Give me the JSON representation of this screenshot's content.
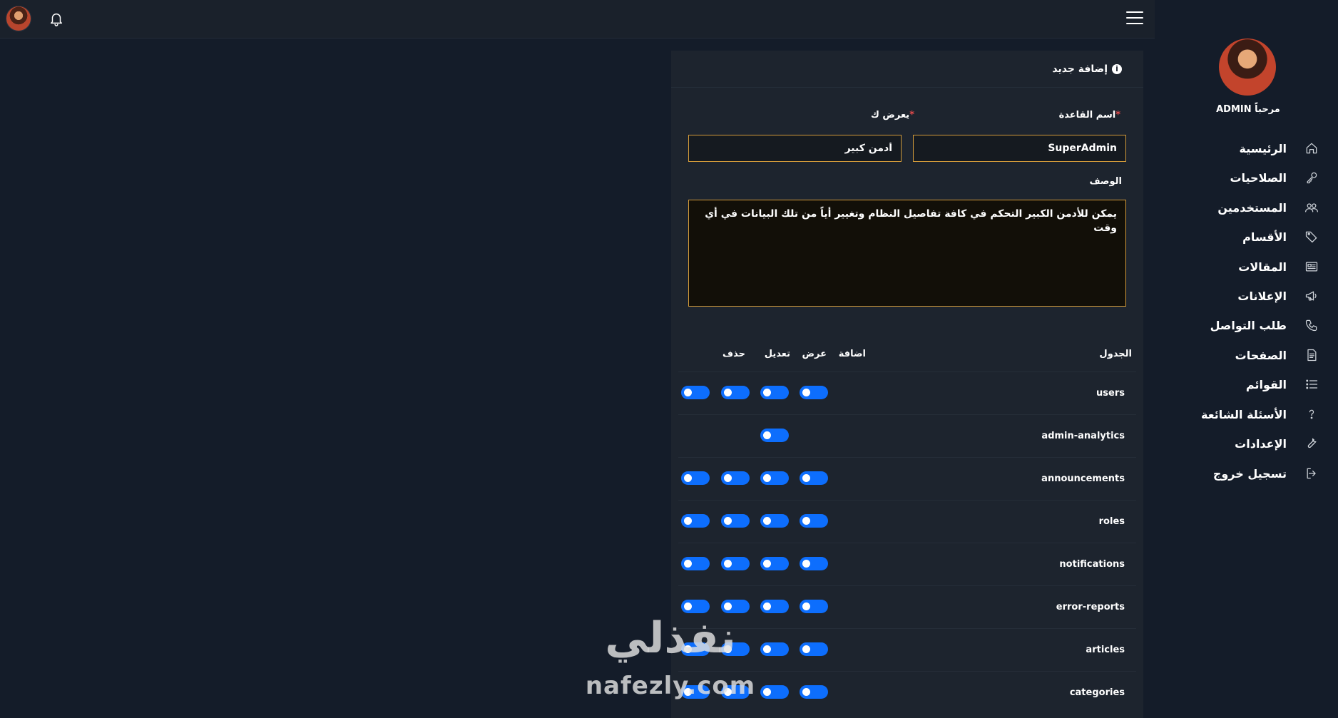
{
  "sidebar": {
    "welcome": "مرحباً ADMIN",
    "items": [
      {
        "label": "الرئيسية",
        "icon": "home-icon"
      },
      {
        "label": "الصلاحيات",
        "icon": "key-icon"
      },
      {
        "label": "المستخدمين",
        "icon": "users-icon"
      },
      {
        "label": "الأقسام",
        "icon": "tag-icon"
      },
      {
        "label": "المقالات",
        "icon": "newspaper-icon"
      },
      {
        "label": "الإعلانات",
        "icon": "megaphone-icon"
      },
      {
        "label": "طلب التواصل",
        "icon": "phone-icon"
      },
      {
        "label": "الصفحات",
        "icon": "page-icon"
      },
      {
        "label": "القوائم",
        "icon": "list-icon"
      },
      {
        "label": "الأسئلة الشائعة",
        "icon": "question-icon"
      },
      {
        "label": "الإعدادات",
        "icon": "wrench-icon"
      },
      {
        "label": "تسجيل خروج",
        "icon": "logout-icon"
      }
    ]
  },
  "form": {
    "title": "إضافة جديد",
    "name_label": "اسم القاعدة",
    "name_value": "SuperAdmin",
    "display_label": "يعرض ك",
    "display_value": "أدمن كبير",
    "required_mark": "*",
    "description_label": "الوصف",
    "description_value": "يمكن للأدمن الكبير التحكم في كافة تفاصيل النظام وتغيير أياً من تلك البيانات في أي وقت"
  },
  "permissions": {
    "headers": {
      "table": "الجدول",
      "add": "اضافة",
      "view": "عرض",
      "edit": "تعديل",
      "delete": "حذف"
    },
    "rows": [
      {
        "name": "users",
        "add": true,
        "view": true,
        "edit": true,
        "delete": true
      },
      {
        "name": "admin-analytics",
        "add": false,
        "view": true,
        "edit": false,
        "delete": false
      },
      {
        "name": "announcements",
        "add": true,
        "view": true,
        "edit": true,
        "delete": true
      },
      {
        "name": "roles",
        "add": true,
        "view": true,
        "edit": true,
        "delete": true
      },
      {
        "name": "notifications",
        "add": true,
        "view": true,
        "edit": true,
        "delete": true
      },
      {
        "name": "error-reports",
        "add": true,
        "view": true,
        "edit": true,
        "delete": true
      },
      {
        "name": "articles",
        "add": true,
        "view": true,
        "edit": true,
        "delete": true
      },
      {
        "name": "categories",
        "add": true,
        "view": true,
        "edit": true,
        "delete": true
      }
    ]
  },
  "watermark": {
    "arabic": "نفذلي",
    "latin": "nafezly.com"
  },
  "colors": {
    "accent": "#0d6efd",
    "input_border": "#d19a3a",
    "required": "#e34b4b"
  }
}
